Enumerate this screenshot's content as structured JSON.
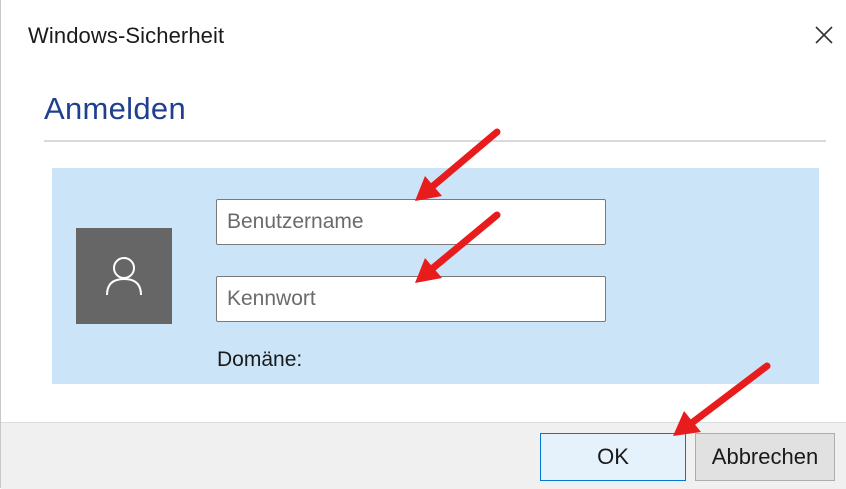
{
  "window": {
    "title": "Windows-Sicherheit",
    "close_icon": "close-icon"
  },
  "heading": "Anmelden",
  "panel": {
    "avatar_icon": "user-icon",
    "username_placeholder": "Benutzername",
    "username_value": "",
    "password_placeholder": "Kennwort",
    "password_value": "",
    "domain_label": "Domäne:"
  },
  "buttons": {
    "ok_label": "OK",
    "cancel_label": "Abbrechen"
  },
  "colors": {
    "heading": "#1f3f8f",
    "panel_bg": "#cce4f7",
    "avatar_bg": "#666666",
    "ok_border": "#0078d7",
    "annotation_arrow": "#e81c1c"
  }
}
